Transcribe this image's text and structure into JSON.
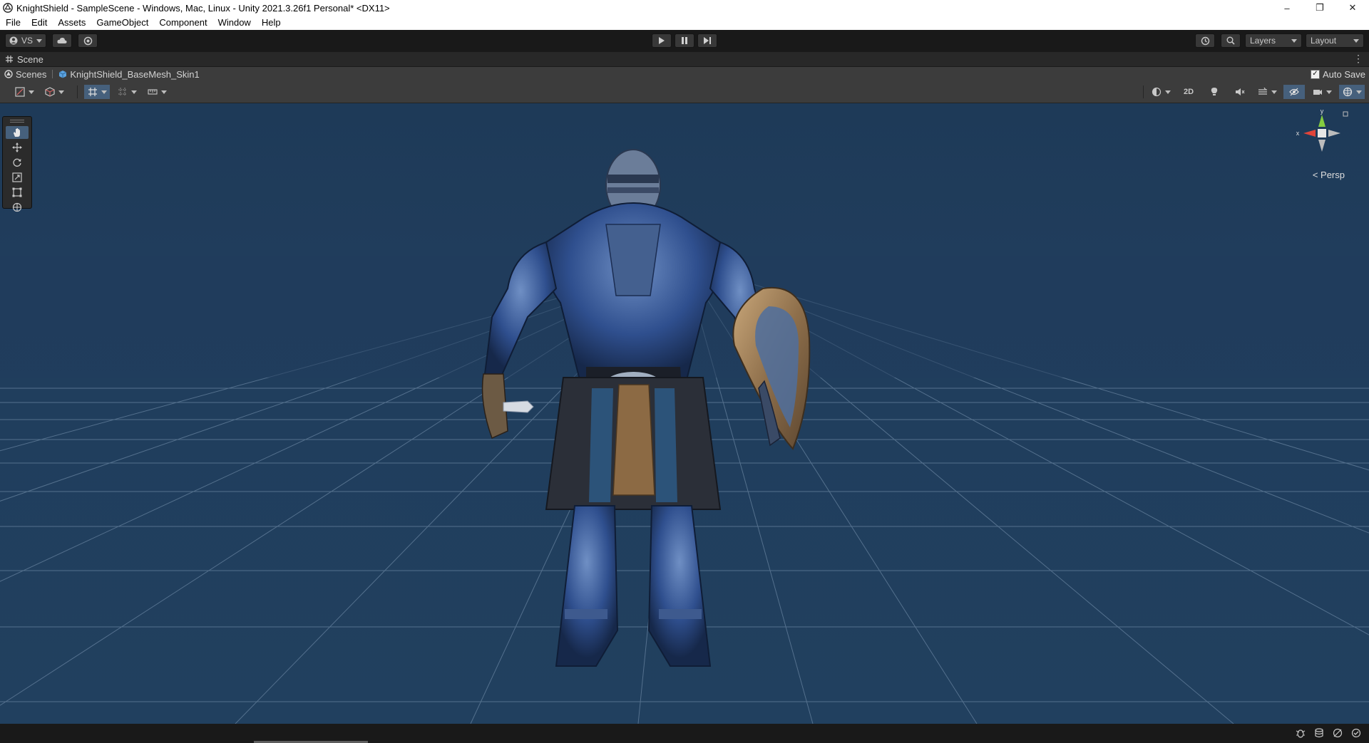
{
  "window": {
    "title": "KnightShield - SampleScene - Windows, Mac, Linux - Unity 2021.3.26f1 Personal* <DX11>",
    "minimize": "–",
    "maximize": "❐",
    "close": "✕"
  },
  "menu": {
    "items": [
      "File",
      "Edit",
      "Assets",
      "GameObject",
      "Component",
      "Window",
      "Help"
    ]
  },
  "toolbar": {
    "account_label": "VS",
    "layers_label": "Layers",
    "layout_label": "Layout"
  },
  "scene_tab": {
    "label": "Scene"
  },
  "breadcrumb": {
    "root": "Scenes",
    "prefab": "KnightShield_BaseMesh_Skin1",
    "auto_save": "Auto Save",
    "auto_save_checked": true
  },
  "scene_toolbar": {
    "mode_2d": "2D"
  },
  "viewport": {
    "persp_label": "Persp",
    "gizmo_x": "x",
    "gizmo_y": "y",
    "background_color": "#203d5c",
    "grid_color": "#5d7996",
    "accent_color": "#46607c"
  },
  "tools": [
    "hand-tool",
    "move-tool",
    "rotate-tool",
    "scale-tool",
    "rect-tool",
    "transform-tool"
  ]
}
